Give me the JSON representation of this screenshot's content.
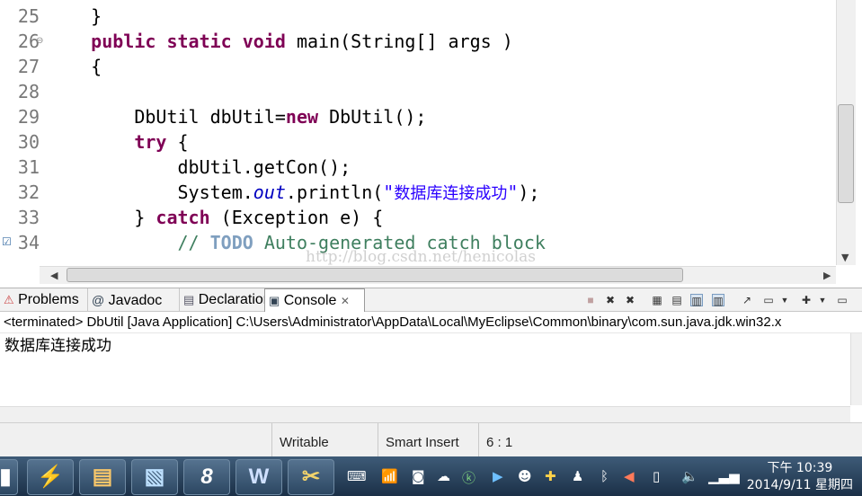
{
  "editor": {
    "lines": [
      {
        "num": "25",
        "text": "    }"
      },
      {
        "num": "26",
        "text": "    public static void main(String[] args )"
      },
      {
        "num": "27",
        "text": "    {"
      },
      {
        "num": "28",
        "text": ""
      },
      {
        "num": "29",
        "text": "        DbUtil dbUtil=new DbUtil();"
      },
      {
        "num": "30",
        "text": "        try {"
      },
      {
        "num": "31",
        "text": "            dbUtil.getCon();"
      },
      {
        "num": "32",
        "text": "            System.out.println(\"数据库连接成功\");"
      },
      {
        "num": "33",
        "text": "        } catch (Exception e) {"
      },
      {
        "num": "34",
        "text": "            // TODO Auto-generated catch block"
      }
    ],
    "tokens": {
      "public": "public",
      "static": "static",
      "void": "void",
      "main_sig": " main(String[] args )",
      "brace_open": "{",
      "brace_close": "}",
      "decl_a": "DbUtil dbUtil=",
      "new": "new",
      "decl_b": " DbUtil();",
      "try": "try",
      "try_rest": " {",
      "getcon": "dbUtil.getCon();",
      "sys": "System.",
      "out": "out",
      "println": ".println(",
      "str_q": "\"",
      "str_text": "数据库连接成功",
      "println_end": ");",
      "catch_close": "} ",
      "catch": "catch",
      "catch_rest": " (Exception e) {",
      "cmt_start": "// ",
      "todo": "TODO",
      "cmt_rest": " Auto-generated catch block"
    },
    "watermark": "http://blog.csdn.net/henicolas"
  },
  "panel": {
    "tabs": [
      {
        "label": "Problems"
      },
      {
        "label": "Javadoc"
      },
      {
        "label": "Declaration"
      },
      {
        "label": "Console"
      }
    ],
    "console_header": "<terminated> DbUtil [Java Application] C:\\Users\\Administrator\\AppData\\Local\\MyEclipse\\Common\\binary\\com.sun.java.jdk.win32.x",
    "console_output": "数据库连接成功"
  },
  "status": {
    "writable": "Writable",
    "insert_mode": "Smart Insert",
    "position": "6 : 1"
  },
  "taskbar": {
    "clock_time": "下午 10:39",
    "clock_date": "2014/9/11 星期四"
  },
  "colors": {
    "keyword": "#7f0055",
    "string": "#2a00ff",
    "comment": "#3f7f5f",
    "field": "#0000c0"
  }
}
